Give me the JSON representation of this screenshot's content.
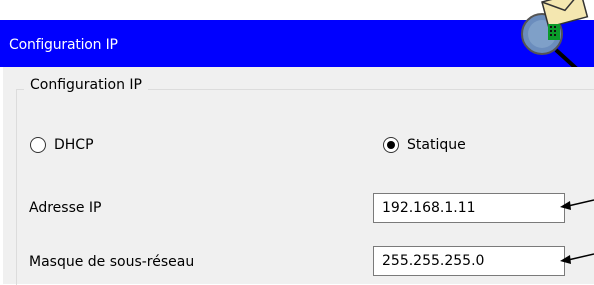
{
  "window": {
    "title": "Configuration IP"
  },
  "group": {
    "legend": "Configuration IP"
  },
  "mode": {
    "dhcp_label": "DHCP",
    "static_label": "Statique",
    "selected": "Statique"
  },
  "fields": {
    "ip_label": "Adresse IP",
    "ip_value": "192.168.1.11",
    "mask_label": "Masque de sous-réseau",
    "mask_value": "255.255.255.0"
  },
  "colors": {
    "titlebar": "#0000ff",
    "panel": "#f0f0f0"
  },
  "icons": {
    "title_icon": "envelope-magnifier-icon",
    "annotation": "arrow-left-icon"
  }
}
